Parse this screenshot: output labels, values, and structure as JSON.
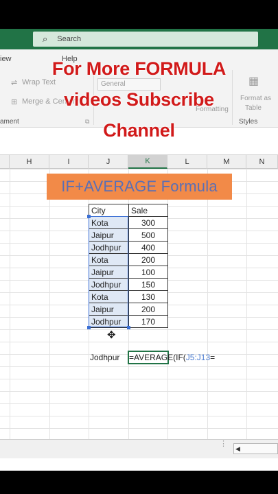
{
  "search": {
    "placeholder": "Search"
  },
  "menu": {
    "view": "iew",
    "help": "Help"
  },
  "ribbon": {
    "wrap_text": "Wrap Text",
    "merge_center": "Merge & Center",
    "number_format": "General",
    "formatting": "Formatting",
    "format_as": "Format as",
    "table": "Table",
    "alignment_group": "ament",
    "styles_group": "Styles"
  },
  "overlay": {
    "line1": "For More FORMULA",
    "line2": "videos Subscribe",
    "line3": "Channel"
  },
  "columns": [
    "H",
    "I",
    "J",
    "K",
    "L",
    "M",
    "N"
  ],
  "active_column": "K",
  "banner": {
    "title": "IF+AVERAGE Formula"
  },
  "table": {
    "headers": [
      "City",
      "Sale"
    ],
    "rows": [
      {
        "city": "Kota",
        "sale": "300"
      },
      {
        "city": "Jaipur",
        "sale": "500"
      },
      {
        "city": "Jodhpur",
        "sale": "400"
      },
      {
        "city": "Kota",
        "sale": "200"
      },
      {
        "city": "Jaipur",
        "sale": "100"
      },
      {
        "city": "Jodhpur",
        "sale": "150"
      },
      {
        "city": "Kota",
        "sale": "130"
      },
      {
        "city": "Jaipur",
        "sale": "200"
      },
      {
        "city": "Jodhpur",
        "sale": "170"
      }
    ]
  },
  "criteria": {
    "value": "Jodhpur"
  },
  "formula": {
    "prefix": "=AVERAGE(IF(",
    "ref": "J5:J13",
    "suffix": "="
  },
  "colors": {
    "excel_green": "#217346",
    "banner_bg": "#f28a48",
    "banner_text": "#5a6fb5",
    "overlay_red": "#d11a1a",
    "selection_blue": "#3b6fd4"
  }
}
